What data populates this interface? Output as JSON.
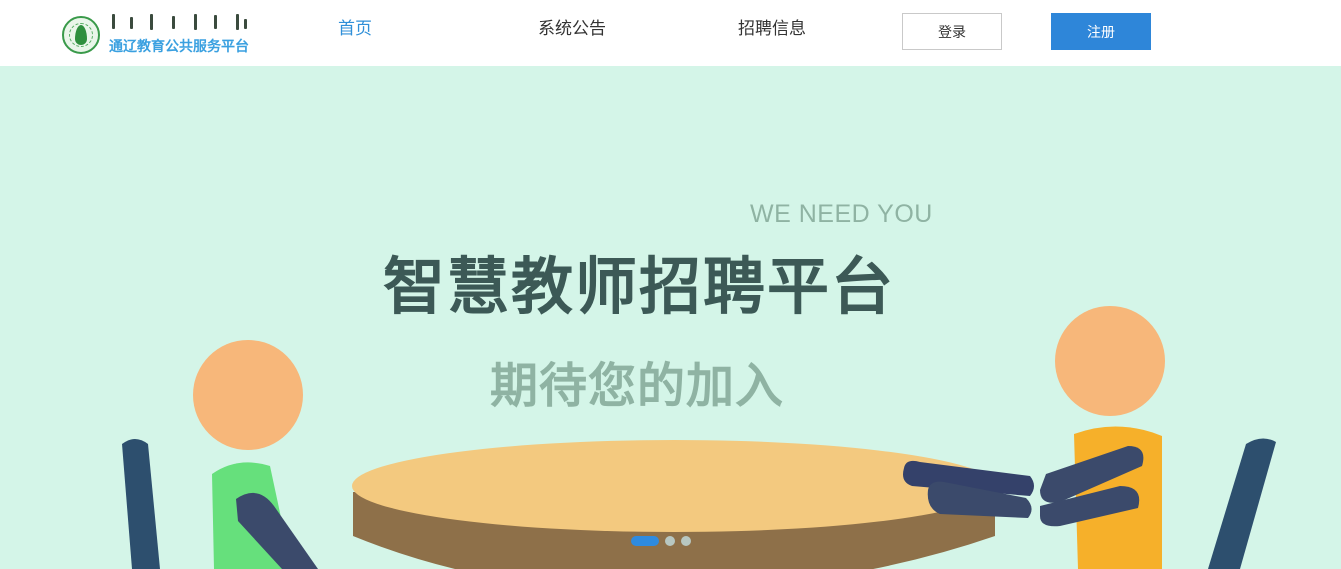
{
  "header": {
    "logo_text": "通辽教育公共服务平台",
    "nav": [
      {
        "label": "首页",
        "active": true
      },
      {
        "label": "系统公告",
        "active": false
      },
      {
        "label": "招聘信息",
        "active": false
      }
    ],
    "login_label": "登录",
    "register_label": "注册"
  },
  "banner": {
    "tagline": "WE NEED YOU",
    "headline": "智慧教师招聘平台",
    "subline": "期待您的加入",
    "slides_count": 3,
    "active_slide": 1
  },
  "colors": {
    "accent": "#2e86d9",
    "banner_bg": "#d4f5e8",
    "headline": "#3c5956",
    "subtle_text": "#8fb3a3"
  },
  "icons": [
    "logo-emblem-icon"
  ]
}
